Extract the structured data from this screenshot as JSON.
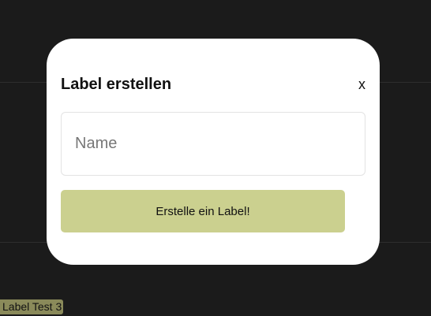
{
  "background": {
    "label_chip": "Label Test 3"
  },
  "modal": {
    "title": "Label erstellen",
    "close_label": "x",
    "name_input": {
      "value": "",
      "placeholder": "Name"
    },
    "create_button_label": "Erstelle ein Label!"
  },
  "colors": {
    "background": "#1b1b1b",
    "modal": "#ffffff",
    "button": "#cbd08f",
    "label_chip": "#8a8a5a"
  }
}
